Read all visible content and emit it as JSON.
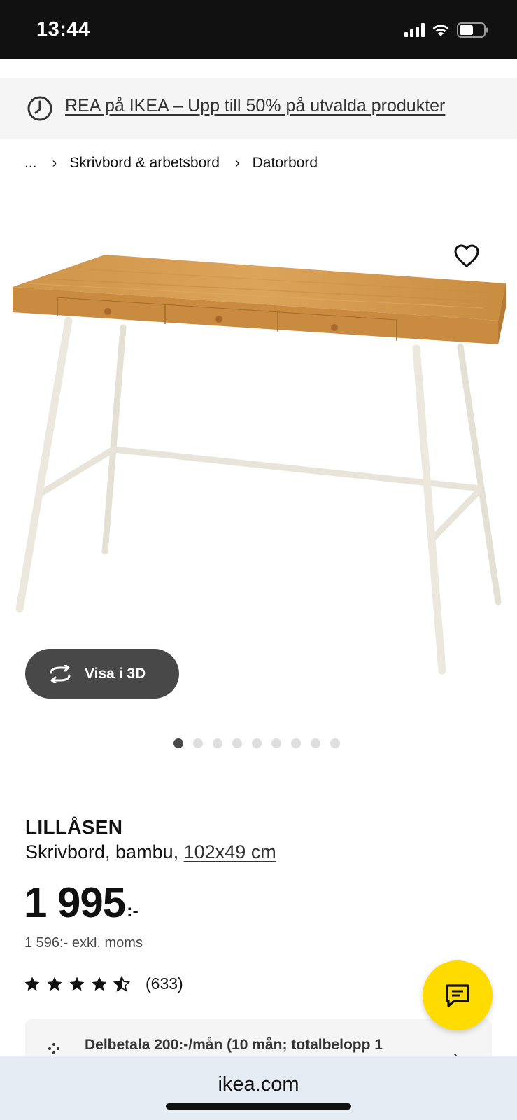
{
  "status_bar": {
    "time": "13:44",
    "icons": [
      "signal-icon",
      "wifi-icon",
      "battery-icon"
    ]
  },
  "promo": {
    "icon": "clock-icon",
    "text": "REA på IKEA – Upp till 50% på utvalda produkter"
  },
  "breadcrumb": {
    "items": [
      "...",
      "Skrivbord & arbetsbord",
      "Datorbord"
    ],
    "separator": "›"
  },
  "gallery": {
    "favorite_icon": "heart-icon",
    "view_3d_icon": "rotate-icon",
    "view_3d_label": "Visa i 3D",
    "image_count": 9,
    "active_index": 0
  },
  "product": {
    "name": "LILLÅSEN",
    "description": "Skrivbord, bambu,",
    "size": "102x49 cm",
    "price_integer": "1 995",
    "price_suffix": ":-",
    "price_excl_vat": "1 596:- exkl. moms",
    "rating_value": 4.5,
    "rating_max": 5,
    "rating_count": "(633)"
  },
  "installment": {
    "icon": "installment-icon",
    "text": "Delbetala 200:-/mån (10 mån; totalbelopp 1",
    "chevron": "›"
  },
  "chat": {
    "icon": "chat-icon"
  },
  "browser": {
    "url": "ikea.com"
  },
  "colors": {
    "accent_yellow": "#ffdb00",
    "dark_button": "#484848",
    "wood": "#d39a4c",
    "legs": "#e8e4da"
  }
}
